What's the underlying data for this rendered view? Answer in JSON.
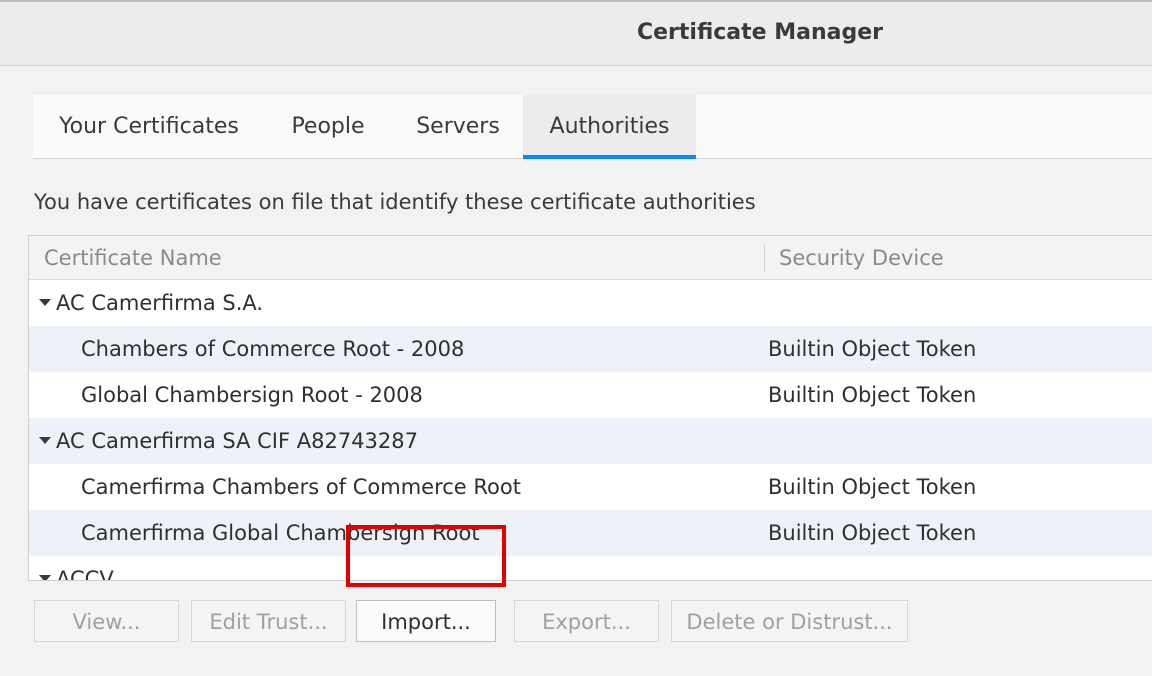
{
  "window": {
    "title": "Certificate Manager"
  },
  "tabs": [
    {
      "label": "Your Certificates"
    },
    {
      "label": "People"
    },
    {
      "label": "Servers"
    },
    {
      "label": "Authorities",
      "active": true
    }
  ],
  "description": "You have certificates on file that identify these certificate authorities",
  "table": {
    "columns": [
      "Certificate Name",
      "Security Device"
    ],
    "rows": [
      {
        "name": "AC Camerfirma S.A.",
        "device": "",
        "group": true
      },
      {
        "name": "Chambers of Commerce Root - 2008",
        "device": "Builtin Object Token"
      },
      {
        "name": "Global Chambersign Root - 2008",
        "device": "Builtin Object Token"
      },
      {
        "name": "AC Camerfirma SA CIF A82743287",
        "device": "",
        "group": true
      },
      {
        "name": "Camerfirma Chambers of Commerce Root",
        "device": "Builtin Object Token"
      },
      {
        "name": "Camerfirma Global Chambersign Root",
        "device": "Builtin Object Token"
      },
      {
        "name": "ACCV",
        "device": "",
        "group": true
      }
    ]
  },
  "buttons": {
    "view": "View...",
    "edit_trust": "Edit Trust...",
    "import": "Import...",
    "export": "Export...",
    "delete": "Delete or Distrust..."
  },
  "colors": {
    "accent": "#0a84ff",
    "highlight": "#e00000"
  }
}
